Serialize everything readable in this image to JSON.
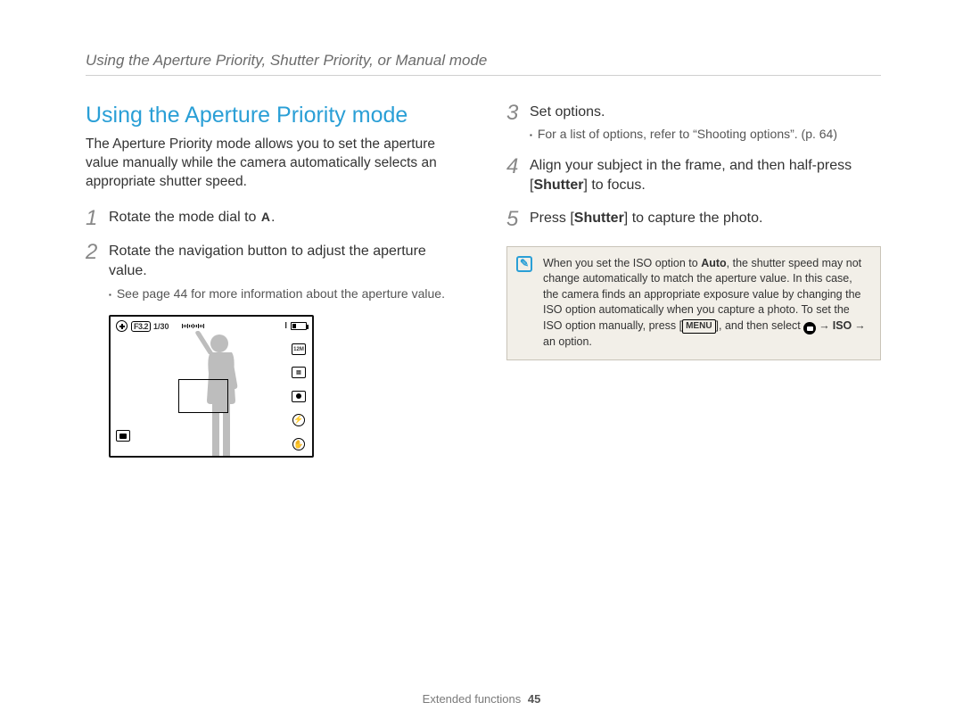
{
  "breadcrumb": "Using the Aperture Priority, Shutter Priority, or Manual mode",
  "heading": "Using the Aperture Priority mode",
  "intro": "The Aperture Priority mode allows you to set the aperture value manually while the camera automatically selects an appropriate shutter speed.",
  "steps": {
    "s1": {
      "num": "1",
      "pre": "Rotate the mode dial to ",
      "icon": "A",
      "post": "."
    },
    "s2": {
      "num": "2",
      "text": "Rotate the navigation button to adjust the aperture value.",
      "sub": "See page 44 for more information about the aperture value."
    },
    "s3": {
      "num": "3",
      "text": "Set options.",
      "sub": "For a list of options, refer to “Shooting options”. (p. 64)"
    },
    "s4": {
      "num": "4",
      "pre": "Align your subject in the frame, and then half-press [",
      "bold": "Shutter",
      "post": "] to focus."
    },
    "s5": {
      "num": "5",
      "pre": "Press [",
      "bold": "Shutter",
      "post": "] to capture the photo."
    }
  },
  "display": {
    "aperture_badge": "F3.2",
    "shutter": "1/30",
    "battery_label": "I",
    "quality_label": "12M",
    "right_icons": [
      "resolution-icon",
      "quality-icon",
      "metering-icon",
      "flash-icon",
      "stabilizer-icon"
    ]
  },
  "note": {
    "pre": "When you set the ISO option to ",
    "bold1": "Auto",
    "mid1": ", the shutter speed may not change automatically to match the aperture value. In this case, the camera finds an appropriate exposure value by changing the ISO option automatically when you capture a photo. To set the ISO option manually, press [",
    "menu": "MENU",
    "mid2": "], and then select ",
    "arrow1": "→",
    "bold2": "ISO",
    "arrow2": "→",
    "post": " an option."
  },
  "footer": {
    "section": "Extended functions",
    "page": "45"
  }
}
